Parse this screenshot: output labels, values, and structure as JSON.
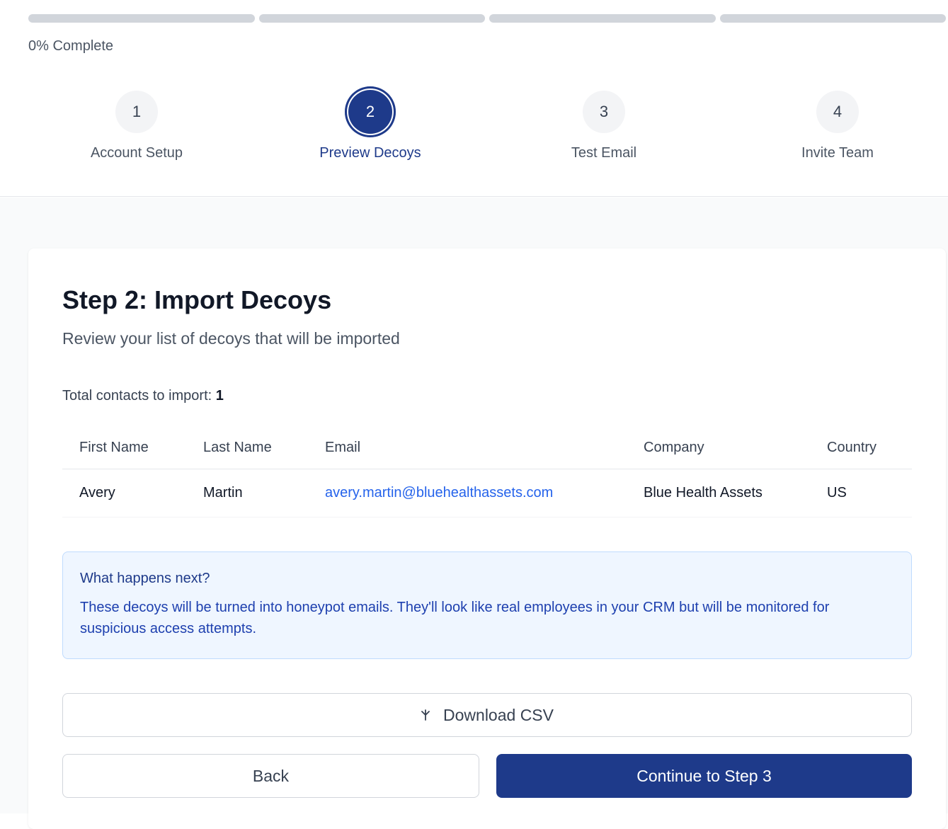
{
  "progress": {
    "percent_label": "0% Complete",
    "percent": 0,
    "segments": 4
  },
  "steps": [
    {
      "number": "1",
      "label": "Account Setup",
      "active": false
    },
    {
      "number": "2",
      "label": "Preview Decoys",
      "active": true
    },
    {
      "number": "3",
      "label": "Test Email",
      "active": false
    },
    {
      "number": "4",
      "label": "Invite Team",
      "active": false
    }
  ],
  "card": {
    "title": "Step 2: Import Decoys",
    "subtitle": "Review your list of decoys that will be imported",
    "total_label": "Total contacts to import:",
    "total_value": "1"
  },
  "table": {
    "headers": [
      "First Name",
      "Last Name",
      "Email",
      "Company",
      "Country"
    ],
    "rows": [
      [
        "Avery",
        "Martin",
        "avery.martin@bluehealthassets.com",
        "Blue Health Assets",
        "US"
      ]
    ]
  },
  "info": {
    "title": "What happens next?",
    "text": "These decoys will be turned into honeypot emails. They'll look like real employees in your CRM but will be monitored for suspicious access attempts."
  },
  "buttons": {
    "download": "Download CSV",
    "back": "Back",
    "continue": "Continue to Step 3"
  },
  "colors": {
    "primary": "#1e3a8a",
    "link": "#2563eb",
    "info_bg": "#eff6ff"
  }
}
